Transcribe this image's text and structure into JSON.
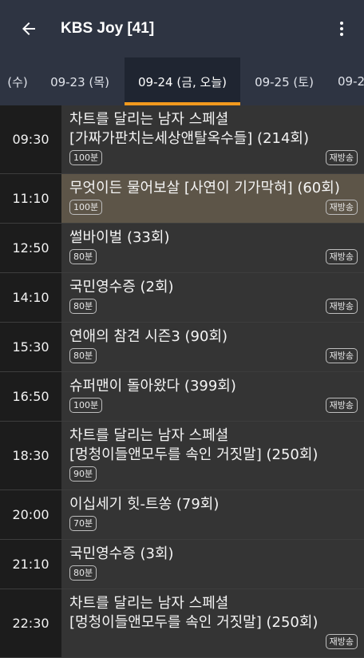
{
  "appbar": {
    "title": "KBS Joy [41]"
  },
  "tabs": [
    {
      "label": "(수)"
    },
    {
      "label": "09-23 (목)"
    },
    {
      "label": "09-24 (금, 오늘)"
    },
    {
      "label": "09-25 (토)"
    },
    {
      "label": "09-2"
    }
  ],
  "schedule": [
    {
      "time": "09:30",
      "title": "차트를 달리는 남자 스페셜",
      "title2": "[가짜가판치는세상앤탈옥수들] (214회)",
      "duration": "100분",
      "badge": "재방송"
    },
    {
      "time": "11:10",
      "title": "무엇이든 물어보살 [사연이 기가막혀] (60회)",
      "title2": "",
      "duration": "100분",
      "badge": "재방송"
    },
    {
      "time": "12:50",
      "title": "썰바이벌 (33회)",
      "title2": "",
      "duration": "80분",
      "badge": "재방송"
    },
    {
      "time": "14:10",
      "title": "국민영수증 (2회)",
      "title2": "",
      "duration": "80분",
      "badge": "재방송"
    },
    {
      "time": "15:30",
      "title": "연애의 참견 시즌3 (90회)",
      "title2": "",
      "duration": "80분",
      "badge": "재방송"
    },
    {
      "time": "16:50",
      "title": "슈퍼맨이 돌아왔다 (399회)",
      "title2": "",
      "duration": "100분",
      "badge": "재방송"
    },
    {
      "time": "18:30",
      "title": "차트를 달리는 남자 스페셜",
      "title2": "[멍청이들앤모두를 속인 거짓말] (250회)",
      "duration": "90분",
      "badge": ""
    },
    {
      "time": "20:00",
      "title": "이십세기 힛-트쏭 (79회)",
      "title2": "",
      "duration": "70분",
      "badge": ""
    },
    {
      "time": "21:10",
      "title": "국민영수증 (3회)",
      "title2": "",
      "duration": "80분",
      "badge": ""
    },
    {
      "time": "22:30",
      "title": "차트를 달리는 남자 스페셜",
      "title2": "[멍청이들앤모두를 속인 거짓말] (250회)",
      "duration": "",
      "badge": "재방송"
    }
  ],
  "colors": {
    "appbar": "#2e3442",
    "accent": "#f29a1e",
    "highlight": "#5d5548"
  },
  "icons": {
    "back": "arrow-left-icon",
    "menu": "more-vert-icon"
  }
}
